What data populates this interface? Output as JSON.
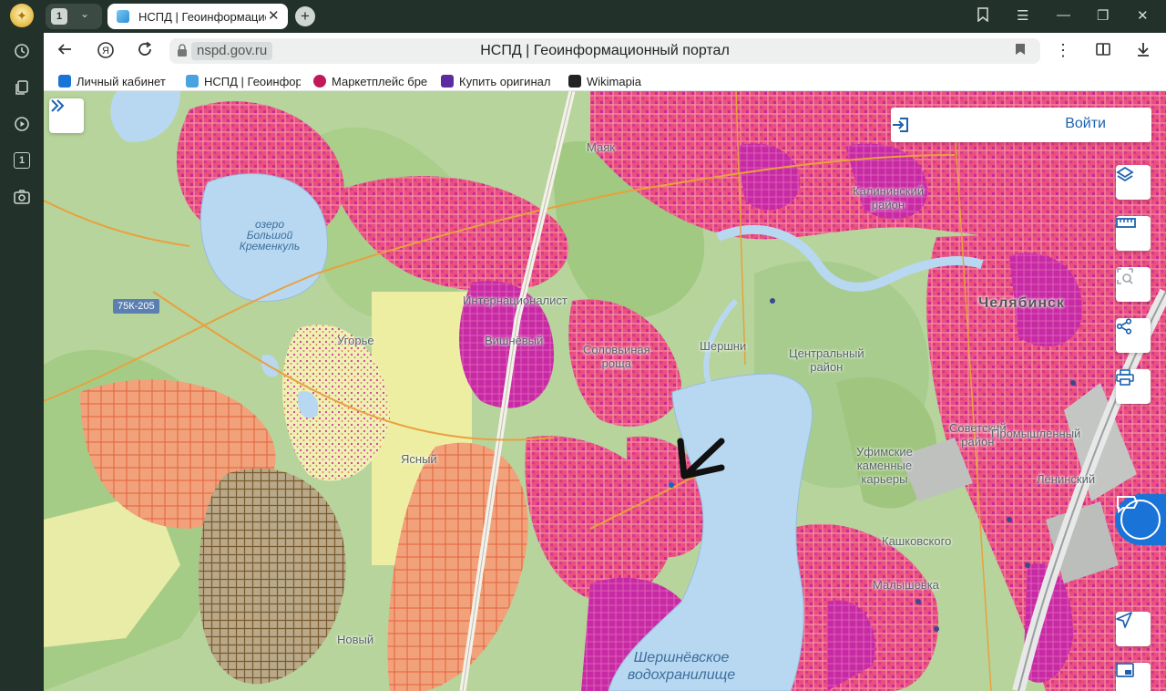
{
  "browser": {
    "tab_group_count": "1",
    "sidebar_counter": "1",
    "tab_title": "НСПД | Геоинформационный портал",
    "url_domain": "nspd.gov.ru",
    "page_title": "НСПД | Геоинформационный портал",
    "bookmarks": [
      {
        "label": "Личный кабинет",
        "color": "#1a73d6"
      },
      {
        "label": "НСПД | Геоинфор",
        "color": "#4aa3e0"
      },
      {
        "label": "Маркетплейс бре",
        "color": "#c2185b"
      },
      {
        "label": "Купить оригинал",
        "color": "#5a2ca0"
      },
      {
        "label": "Wikimapia",
        "color": "#222222"
      }
    ]
  },
  "map": {
    "login_label": "Войти",
    "road_badge": "75К-205",
    "labels": {
      "lake_kremenkul": "озеро\nБольшой\nКременкуль",
      "reservoir": "Шершнёвское\nводохранилище",
      "city": "Челябинск",
      "central_district": "Центральный\nрайон",
      "kalininsky": "Калининский\nрайон",
      "sovetsky": "Советский\nрайон",
      "ufimskie": "Уфимские\nкаменные\nкарьеры",
      "internatsionalist": "Интернационалист",
      "solovinaya": "Соловьиная\nроща",
      "shershni": "Шершни",
      "vishnevy": "Вишнёвый",
      "malyshevka": "Малышевка",
      "kashkovskogo": "Кашковского",
      "yasny": "Ясный",
      "ugorye": "Угорье",
      "mayak": "Маяк",
      "promyshlenny": "Промышленный",
      "leninsky": "Ленинский",
      "novy": "Новый"
    }
  },
  "colors": {
    "accent": "#1d62b0",
    "urban_pink": "#e83e7a",
    "urban_magenta": "#c42a9d",
    "forest": "#a8cc8e",
    "water": "#b8d8f2"
  }
}
